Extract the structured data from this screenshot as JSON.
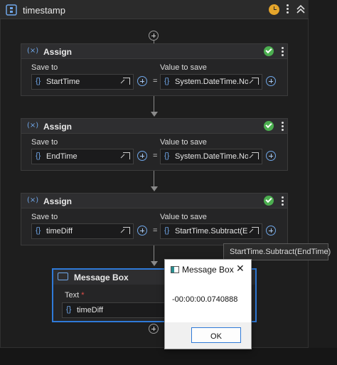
{
  "sequence": {
    "title": "timestamp",
    "icons": [
      "sequence-icon",
      "clock-icon",
      "more-options-icon",
      "collapse-icon"
    ]
  },
  "labels": {
    "save_to": "Save to",
    "value_to_save": "Value to save",
    "equals": "="
  },
  "assigns": [
    {
      "title": "Assign",
      "save_to": "StartTime",
      "value": "System.DateTime.Now"
    },
    {
      "title": "Assign",
      "save_to": "EndTime",
      "value": "System.DateTime.Now"
    },
    {
      "title": "Assign",
      "save_to": "timeDiff",
      "value": "StartTime.Subtract(EndTime)"
    }
  ],
  "tooltip": {
    "text": "StartTime.Subtract(EndTime)"
  },
  "message_box_activity": {
    "title": "Message Box",
    "text_label": "Text",
    "required": "*",
    "text_value": "timeDiff"
  },
  "dialog": {
    "title": "Message Box",
    "close": "✕",
    "message": "-00:00:00.0740888",
    "ok_label": "OK"
  },
  "colors": {
    "accent": "#2f7ad8",
    "valid": "#4caf50",
    "warning": "#e5a52b"
  }
}
